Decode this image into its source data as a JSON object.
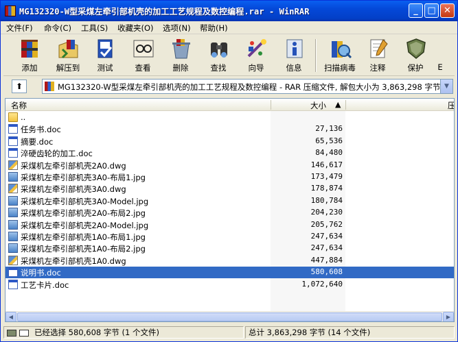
{
  "window": {
    "title": "MG132320-W型采煤左牵引部机壳的加工工艺规程及数控编程.rar - WinRAR",
    "minimize": "_",
    "maximize": "□",
    "close": "✕"
  },
  "menu": [
    "文件(F)",
    "命令(C)",
    "工具(S)",
    "收藏夹(O)",
    "选项(N)",
    "帮助(H)"
  ],
  "toolbar": [
    {
      "label": "添加",
      "icon": "add-archive-icon"
    },
    {
      "label": "解压到",
      "icon": "extract-to-icon"
    },
    {
      "label": "测试",
      "icon": "test-icon"
    },
    {
      "label": "查看",
      "icon": "view-icon"
    },
    {
      "label": "删除",
      "icon": "delete-icon"
    },
    {
      "label": "查找",
      "icon": "find-binoculars-icon"
    },
    {
      "label": "向导",
      "icon": "wizard-icon"
    },
    {
      "label": "信息",
      "icon": "info-icon"
    },
    {
      "label": "扫描病毒",
      "icon": "virus-scan-icon"
    },
    {
      "label": "注释",
      "icon": "comment-icon"
    },
    {
      "label": "保护",
      "icon": "protect-shield-icon"
    },
    {
      "label": "E",
      "icon": "sfx-icon"
    }
  ],
  "address": {
    "text": "MG132320-W型采煤左牵引部机壳的加工工艺规程及数控编程 - RAR 压缩文件, 解包大小为 3,863,298 字节",
    "up_icon": "up-folder-icon"
  },
  "columns": {
    "name": "名称",
    "size": "大小",
    "packed": "压"
  },
  "files": [
    {
      "name": "..",
      "size": "",
      "type": "folder"
    },
    {
      "name": "任务书.doc",
      "size": "27,136",
      "type": "doc"
    },
    {
      "name": "摘要.doc",
      "size": "65,536",
      "type": "doc"
    },
    {
      "name": "淬硬齿轮的加工.doc",
      "size": "84,480",
      "type": "doc"
    },
    {
      "name": "采煤机左牵引部机壳2A0.dwg",
      "size": "146,617",
      "type": "dwg"
    },
    {
      "name": "采煤机左牵引部机壳3A0-布局1.jpg",
      "size": "173,479",
      "type": "jpg"
    },
    {
      "name": "采煤机左牵引部机壳3A0.dwg",
      "size": "178,874",
      "type": "dwg"
    },
    {
      "name": "采煤机左牵引部机壳3A0-Model.jpg",
      "size": "180,784",
      "type": "jpg"
    },
    {
      "name": "采煤机左牵引部机壳2A0-布局2.jpg",
      "size": "204,230",
      "type": "jpg"
    },
    {
      "name": "采煤机左牵引部机壳2A0-Model.jpg",
      "size": "205,762",
      "type": "jpg"
    },
    {
      "name": "采煤机左牵引部机壳1A0-布局1.jpg",
      "size": "247,634",
      "type": "jpg"
    },
    {
      "name": "采煤机左牵引部机壳1A0-布局2.jpg",
      "size": "247,634",
      "type": "jpg"
    },
    {
      "name": "采煤机左牵引部机壳1A0.dwg",
      "size": "447,884",
      "type": "dwg"
    },
    {
      "name": "说明书.doc",
      "size": "580,608",
      "type": "doc",
      "selected": true
    },
    {
      "name": "工艺卡片.doc",
      "size": "1,072,640",
      "type": "doc"
    }
  ],
  "status": {
    "selected": "已经选择 580,608 字节 (1 个文件)",
    "total": "总计 3,863,298 字节 (14 个文件)"
  },
  "colors": {
    "titlebar": "#0448d8",
    "selection": "#316ac5",
    "window_bg": "#ece9d8"
  }
}
